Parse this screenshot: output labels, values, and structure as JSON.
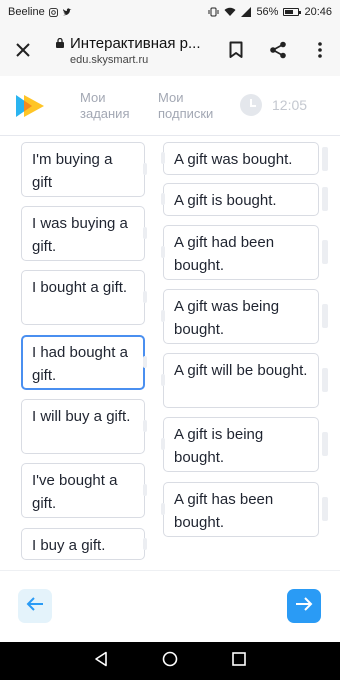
{
  "status_bar": {
    "carrier": "Beeline",
    "battery": "56%",
    "time": "20:46"
  },
  "browser": {
    "page_title": "Интерактивная р...",
    "url": "edu.skysmart.ru",
    "icons": [
      "close-icon",
      "lock-icon",
      "bookmark-icon",
      "share-icon",
      "more-icon"
    ]
  },
  "header": {
    "nav": [
      {
        "line1": "Мои",
        "line2": "задания"
      },
      {
        "line1": "Мои",
        "line2": "подписки"
      }
    ],
    "timer": "12:05"
  },
  "exercise": {
    "left_cards": [
      {
        "text": "I'm buying a gift",
        "selected": false
      },
      {
        "text": "I was buying a gift.",
        "selected": false
      },
      {
        "text": "I bought a gift.",
        "selected": false
      },
      {
        "text": "I had bought a gift.",
        "selected": true
      },
      {
        "text": "I will buy a gift.",
        "selected": false
      },
      {
        "text": "I've bought a gift.",
        "selected": false
      },
      {
        "text": "I buy a gift.",
        "selected": false
      }
    ],
    "right_cards": [
      {
        "text": "A gift was bought."
      },
      {
        "text": "A gift is bought."
      },
      {
        "text": "A gift had been bought."
      },
      {
        "text": "A gift was being bought."
      },
      {
        "text": "A gift will be bought."
      },
      {
        "text": "A gift is being bought."
      },
      {
        "text": "A gift has been bought."
      }
    ]
  },
  "footer": {
    "icons": [
      "arrow-left-icon",
      "arrow-right-icon"
    ],
    "colors": {
      "back_bg": "#e4f3fb",
      "next_bg": "#2a9bf5",
      "selected_border": "#4a8ff0"
    }
  }
}
